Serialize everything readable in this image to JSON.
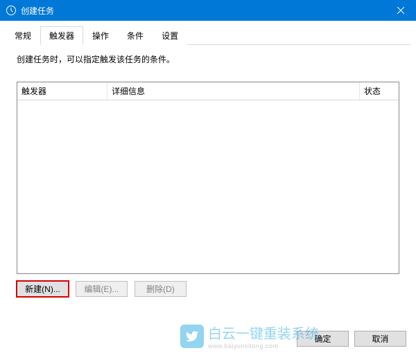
{
  "titlebar": {
    "title": "创建任务"
  },
  "tabs": {
    "general": "常规",
    "triggers": "触发器",
    "actions": "操作",
    "conditions": "条件",
    "settings": "设置"
  },
  "content": {
    "description": "创建任务时，可以指定触发该任务的条件。"
  },
  "table": {
    "headers": {
      "trigger": "触发器",
      "detail": "详细信息",
      "status": "状态"
    },
    "rows": []
  },
  "actions": {
    "new": "新建(N)...",
    "edit": "编辑(E)...",
    "delete": "删除(D)"
  },
  "footer": {
    "ok": "确定",
    "cancel": "取消"
  },
  "watermark": {
    "text": "白云一键重装系统",
    "url": "www.baiyunxitong.com"
  }
}
